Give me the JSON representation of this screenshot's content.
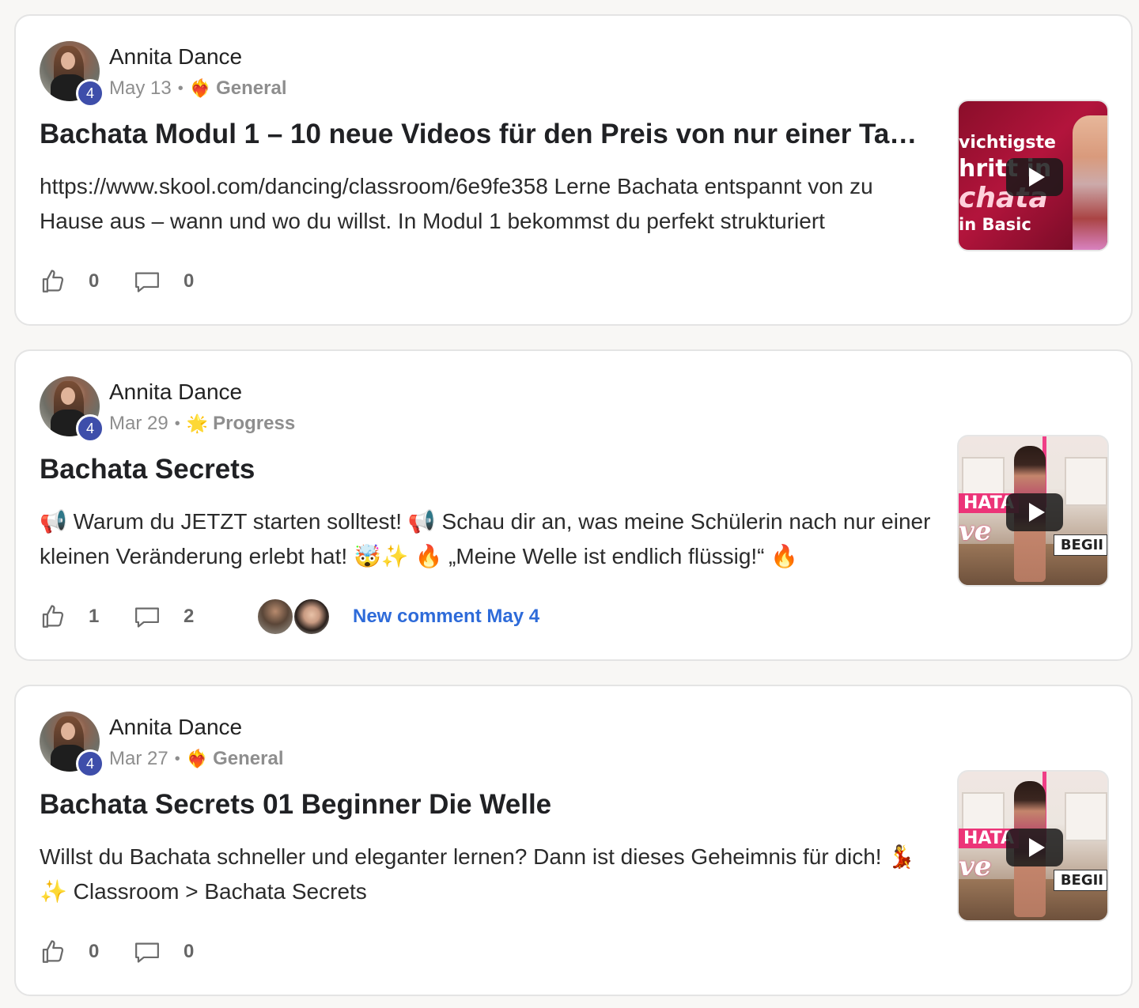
{
  "posts": [
    {
      "author": "Annita Dance",
      "level": "4",
      "date": "May 13",
      "separator": "•",
      "category_emoji": "❤️‍🔥",
      "category": "General",
      "title": "Bachata Modul 1 – 10 neue Videos für den Preis von nur einer Tan...",
      "body": "https://www.skool.com/dancing/classroom/6e9fe358 Lerne Bachata entspannt von zu Hause aus – wann und wo du willst. In Modul 1 bekommst du perfekt strukturiert",
      "likes": "0",
      "comments": "0",
      "thumbnail": {
        "style": "red-title",
        "lines": [
          "vichtigste",
          "hritt in",
          "chata",
          "in Basic"
        ]
      }
    },
    {
      "author": "Annita Dance",
      "level": "4",
      "date": "Mar 29",
      "separator": "•",
      "category_emoji": "🌟",
      "category": "Progress",
      "title": "Bachata Secrets",
      "body": "📢 Warum du JETZT starten solltest! 📢 Schau dir an, was meine Schülerin nach nur einer kleinen Veränderung erlebt hat! 🤯✨ 🔥 „Meine Welle ist endlich flüssig!“ 🔥",
      "likes": "1",
      "comments": "2",
      "new_comment": "New comment May 4",
      "thumbnail": {
        "style": "studio",
        "lines": [
          "HATA",
          "ve",
          "BEGII"
        ]
      }
    },
    {
      "author": "Annita Dance",
      "level": "4",
      "date": "Mar 27",
      "separator": "•",
      "category_emoji": "❤️‍🔥",
      "category": "General",
      "title": "Bachata Secrets 01 Beginner Die Welle",
      "body": "Willst du Bachata schneller und eleganter lernen? Dann ist dieses Geheimnis für dich! 💃✨ Classroom > Bachata Secrets",
      "likes": "0",
      "comments": "0",
      "thumbnail": {
        "style": "studio",
        "lines": [
          "HATA",
          "ve",
          "BEGII"
        ]
      }
    }
  ],
  "icons": {
    "like": "thumbs-up-icon",
    "comment": "speech-bubble-icon",
    "play": "play-icon"
  },
  "colors": {
    "badge": "#3e4eaa",
    "link": "#2e6bd9",
    "thumb_red": "#b3143c",
    "thumb_pink": "#ec3478"
  }
}
